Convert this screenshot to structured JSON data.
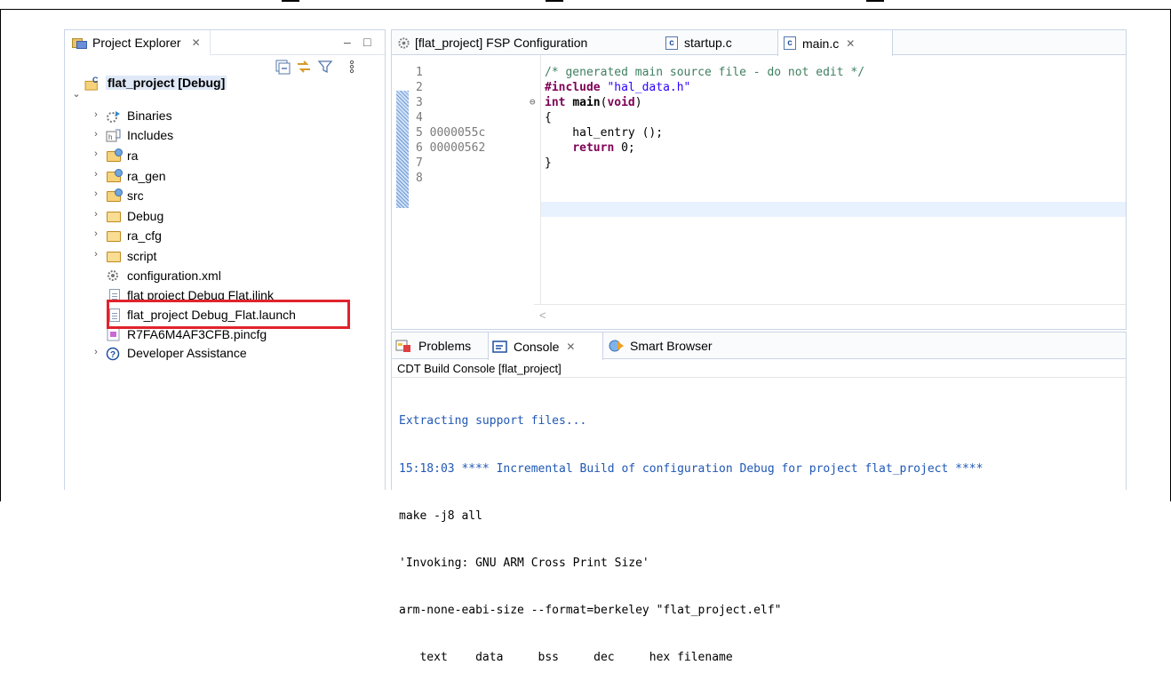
{
  "project_explorer": {
    "tab_label": "Project Explorer",
    "close_glyph": "✕",
    "minimize_glyph": "–",
    "maximize_glyph": "□",
    "tree": [
      {
        "label": "flat_project [Debug]",
        "icon": "c-project-icon",
        "expanded": true
      },
      {
        "label": "Binaries",
        "icon": "binaries-icon"
      },
      {
        "label": "Includes",
        "icon": "includes-icon"
      },
      {
        "label": "ra",
        "icon": "source-folder-icon"
      },
      {
        "label": "ra_gen",
        "icon": "source-folder-icon"
      },
      {
        "label": "src",
        "icon": "source-folder-icon"
      },
      {
        "label": "Debug",
        "icon": "folder-icon"
      },
      {
        "label": "ra_cfg",
        "icon": "folder-icon"
      },
      {
        "label": "script",
        "icon": "folder-icon"
      },
      {
        "label": "configuration.xml",
        "icon": "gear-file-icon"
      },
      {
        "label": "flat project Debug Flat.jlink",
        "icon": "file-icon"
      },
      {
        "label": "flat_project Debug_Flat.launch",
        "icon": "file-icon",
        "highlighted": true
      },
      {
        "label": "R7FA6M4AF3CFB.pincfg",
        "icon": "pincfg-icon"
      },
      {
        "label": "Developer Assistance",
        "icon": "help-icon"
      }
    ]
  },
  "editor": {
    "tabs": [
      {
        "label": "[flat_project] FSP Configuration",
        "icon": "gear-icon"
      },
      {
        "label": "startup.c",
        "icon": "c-file-icon"
      },
      {
        "label": "main.c",
        "icon": "c-file-icon",
        "active": true
      }
    ],
    "close_glyph": "✕",
    "line_numbers": [
      "1",
      "2",
      "3",
      "4",
      "5 0000055c",
      "6 00000562",
      "7",
      "8"
    ],
    "code": [
      "/* generated main source file - do not edit */",
      "#include \"hal_data.h\"",
      "int main(void)",
      "{",
      "    hal_entry ();",
      "    return 0;",
      "}",
      ""
    ],
    "scroll_left_glyph": "<"
  },
  "console": {
    "tabs": [
      {
        "label": "Problems",
        "icon": "problems-icon"
      },
      {
        "label": "Console",
        "icon": "console-icon",
        "active": true
      },
      {
        "label": "Smart Browser",
        "icon": "smart-browser-icon"
      }
    ],
    "close_glyph": "✕",
    "title": "CDT Build Console [flat_project]",
    "lines": [
      "Extracting support files...",
      "15:18:03 **** Incremental Build of configuration Debug for project flat_project ****",
      "make -j8 all",
      "'Invoking: GNU ARM Cross Print Size'",
      "arm-none-eabi-size --format=berkeley \"flat_project.elf\"",
      "   text    data     bss     dec     hex filename"
    ]
  },
  "colors": {
    "highlight_box": "#e0232c",
    "panel_border": "#c9d5e5",
    "keyword": "#7f0055",
    "comment": "#3f7f5f",
    "string": "#2a00ff",
    "console_blue": "#1f57b5"
  }
}
